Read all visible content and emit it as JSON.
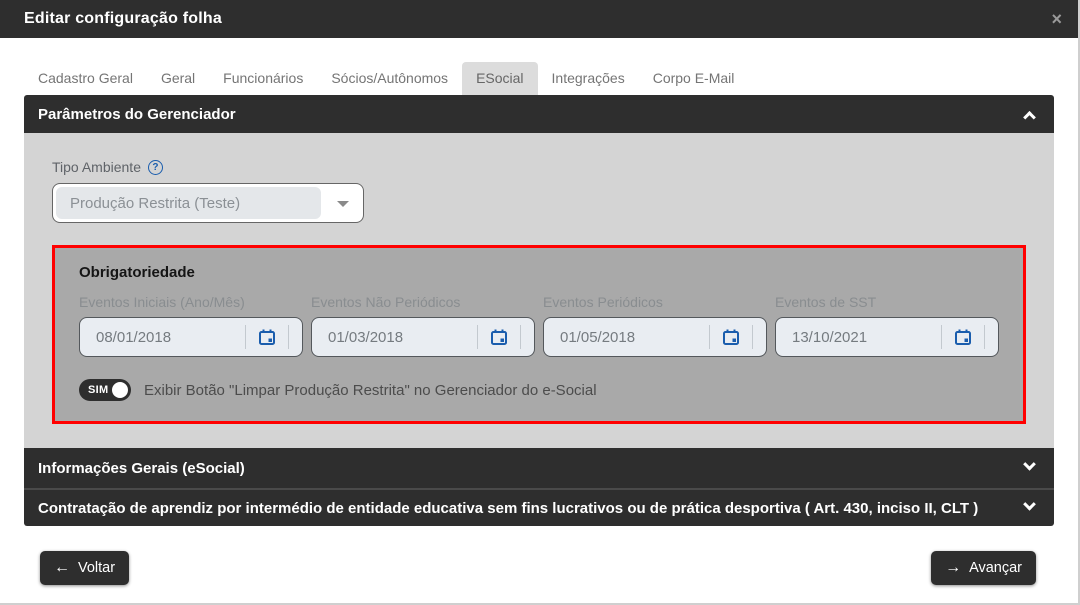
{
  "colors": {
    "dark": "#2e2e2e",
    "panel_gray": "#d4d4d4",
    "mandatory_box_gray": "#a9a9a9",
    "mandatory_border_red": "#ff0000",
    "field_background": "#e9edf2",
    "accent_blue": "#1a5dad",
    "muted_text": "#757575"
  },
  "titlebar": {
    "title": "Editar configuração folha",
    "close_icon": "×"
  },
  "tabs": [
    {
      "label": "Cadastro Geral"
    },
    {
      "label": "Geral"
    },
    {
      "label": "Funcionários"
    },
    {
      "label": "Sócios/Autônomos"
    },
    {
      "label": "ESocial",
      "active": true
    },
    {
      "label": "Integrações"
    },
    {
      "label": "Corpo E-Mail"
    }
  ],
  "accordions": {
    "parametros": {
      "title": "Parâmetros do Gerenciador",
      "expanded": true,
      "tipo_ambiente": {
        "label": "Tipo Ambiente",
        "help_icon": "?",
        "value": "Produção Restrita (Teste)"
      },
      "obrigatoriedade": {
        "title": "Obrigatoriedade",
        "fields": [
          {
            "label": "Eventos Iniciais (Ano/Mês)",
            "value": "08/01/2018"
          },
          {
            "label": "Eventos Não Periódicos",
            "value": "01/03/2018"
          },
          {
            "label": "Eventos Periódicos",
            "value": "01/05/2018"
          },
          {
            "label": "Eventos de SST",
            "value": "13/10/2021"
          }
        ],
        "toggle": {
          "state": "SIM",
          "label": "Exibir Botão \"Limpar Produção Restrita\" no Gerenciador do e-Social"
        }
      }
    },
    "informacoes": {
      "title": "Informações Gerais (eSocial)",
      "expanded": false
    },
    "contratacao": {
      "title": "Contratação de aprendiz por intermédio de entidade educativa sem fins lucrativos ou de prática desportiva ( Art. 430, inciso II, CLT )",
      "expanded": false
    }
  },
  "footer": {
    "back_arrow": "←",
    "back_label": "Voltar",
    "next_arrow": "→",
    "next_label": "Avançar"
  }
}
